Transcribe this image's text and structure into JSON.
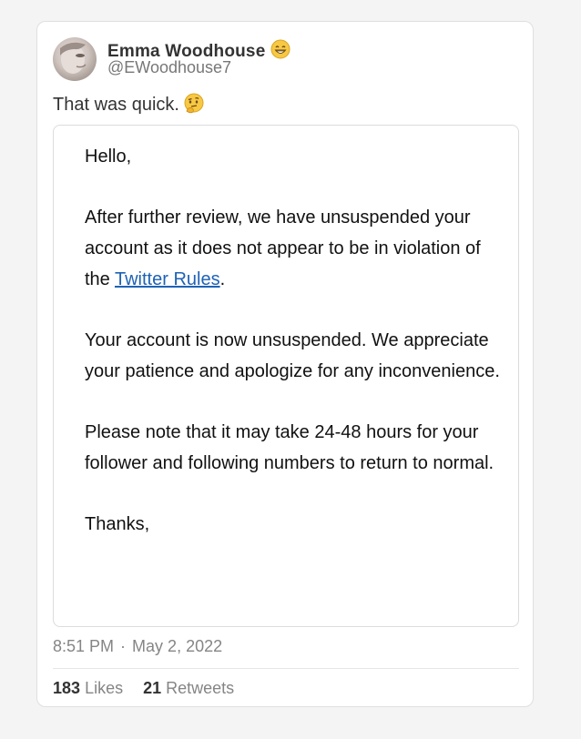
{
  "user": {
    "name": "Emma Woodhouse",
    "name_emoji_icon": "grinning-face-icon",
    "handle": "@EWoodhouse7"
  },
  "tweet": {
    "text": "That was quick.",
    "text_emoji_icon": "thinking-face-icon"
  },
  "embed": {
    "greeting": "Hello,",
    "p1_before": "After further review, we have unsuspended your account as it does not appear to be in violation of the ",
    "p1_link": "Twitter Rules",
    "p1_after": ".",
    "p2": "Your account is now unsuspended. We appreciate your patience and apologize for any inconvenience.",
    "p3": "Please note that it may take 24-48 hours for your follower and following numbers to return to normal.",
    "closing": "Thanks,"
  },
  "meta": {
    "time": "8:51 PM",
    "separator": "·",
    "date": "May 2, 2022"
  },
  "stats": {
    "likes_count": "183",
    "likes_label": "Likes",
    "retweets_count": "21",
    "retweets_label": "Retweets"
  },
  "colors": {
    "link": "#1d62b5",
    "muted": "#858585"
  }
}
